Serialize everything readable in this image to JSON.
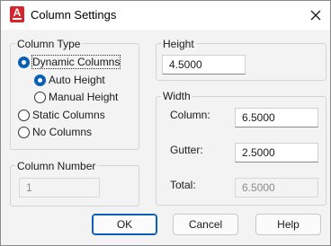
{
  "window": {
    "title": "Column Settings",
    "icon": "autocad-app-icon",
    "icon_letter": "A"
  },
  "column_type": {
    "legend": "Column Type",
    "options": [
      {
        "label": "Dynamic Columns",
        "checked": true
      },
      {
        "label": "Static Columns",
        "checked": false
      },
      {
        "label": "No Columns",
        "checked": false
      }
    ],
    "sub_options": [
      {
        "label": "Auto Height",
        "checked": true
      },
      {
        "label": "Manual Height",
        "checked": false
      }
    ]
  },
  "column_number": {
    "legend": "Column Number",
    "value": "1",
    "disabled": true
  },
  "height": {
    "legend": "Height",
    "value": "4.5000"
  },
  "width": {
    "legend": "Width",
    "column_label": "Column:",
    "column_value": "6.5000",
    "gutter_label": "Gutter:",
    "gutter_value": "2.5000",
    "total_label": "Total:",
    "total_value": "6.5000"
  },
  "buttons": {
    "ok": "OK",
    "cancel": "Cancel",
    "help": "Help"
  },
  "colors": {
    "accent": "#0a5fb4",
    "icon_red": "#d6262a"
  }
}
